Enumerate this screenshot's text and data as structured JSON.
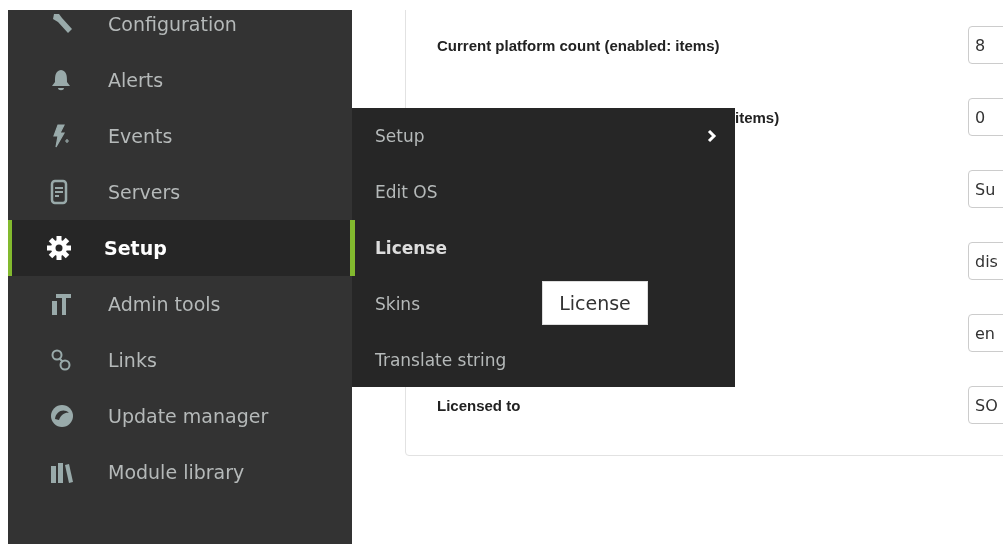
{
  "sidebar": {
    "items": [
      {
        "label": "Configuration",
        "selected": false
      },
      {
        "label": "Alerts",
        "selected": false
      },
      {
        "label": "Events",
        "selected": false
      },
      {
        "label": "Servers",
        "selected": false
      },
      {
        "label": "Setup",
        "selected": true
      },
      {
        "label": "Admin tools",
        "selected": false
      },
      {
        "label": "Links",
        "selected": false
      },
      {
        "label": "Update manager",
        "selected": false
      },
      {
        "label": "Module library",
        "selected": false
      }
    ]
  },
  "submenu": {
    "items": [
      {
        "label": "Setup",
        "selected": false,
        "has_submenu": true
      },
      {
        "label": "Edit OS",
        "selected": false,
        "has_submenu": false
      },
      {
        "label": "License",
        "selected": true,
        "has_submenu": false
      },
      {
        "label": "Skins",
        "selected": false,
        "has_submenu": false
      },
      {
        "label": "Translate string",
        "selected": false,
        "has_submenu": false
      }
    ]
  },
  "tooltip": {
    "text": "License"
  },
  "form": {
    "rows": [
      {
        "label": "Current platform count (enabled: items)",
        "value": "8"
      },
      {
        "label": "items)",
        "covered": true,
        "value": "0"
      },
      {
        "value": "Su"
      },
      {
        "value": "dis"
      },
      {
        "value": "en"
      },
      {
        "label": "Licensed to",
        "value": "SO"
      }
    ]
  }
}
